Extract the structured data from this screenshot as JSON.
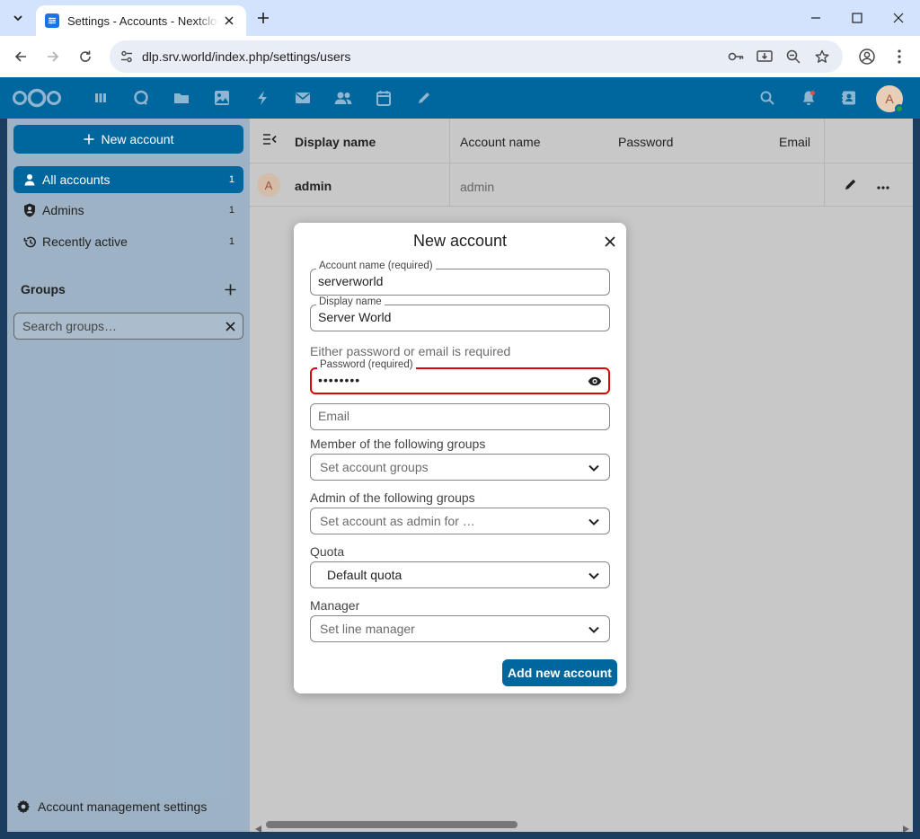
{
  "browser": {
    "tab_title": "Settings - Accounts - Nextcloud",
    "url": "dlp.srv.world/index.php/settings/users"
  },
  "header": {
    "avatar_initial": "A"
  },
  "sidebar": {
    "new_account_label": "New account",
    "items": [
      {
        "label": "All accounts",
        "count": "1"
      },
      {
        "label": "Admins",
        "count": "1"
      },
      {
        "label": "Recently active",
        "count": "1"
      }
    ],
    "groups_title": "Groups",
    "group_search_placeholder": "Search groups…",
    "settings_label": "Account management settings"
  },
  "table": {
    "columns": [
      "Display name",
      "Account name",
      "Password",
      "Email"
    ],
    "rows": [
      {
        "avatar": "A",
        "display_name": "admin",
        "account_name": "admin"
      }
    ]
  },
  "modal": {
    "title": "New account",
    "account_name_label": "Account name (required)",
    "account_name_value": "serverworld",
    "display_name_label": "Display name",
    "display_name_value": "Server World",
    "hint": "Either password or email is required",
    "password_label": "Password (required)",
    "password_value": "serverwo",
    "email_placeholder": "Email",
    "member_groups_label": "Member of the following groups",
    "member_groups_placeholder": "Set account groups",
    "admin_groups_label": "Admin of the following groups",
    "admin_groups_placeholder": "Set account as admin for …",
    "quota_label": "Quota",
    "quota_value": "Default quota",
    "manager_label": "Manager",
    "manager_placeholder": "Set line manager",
    "submit_label": "Add new account"
  },
  "colors": {
    "primary": "#00679e",
    "error": "#db0606"
  }
}
